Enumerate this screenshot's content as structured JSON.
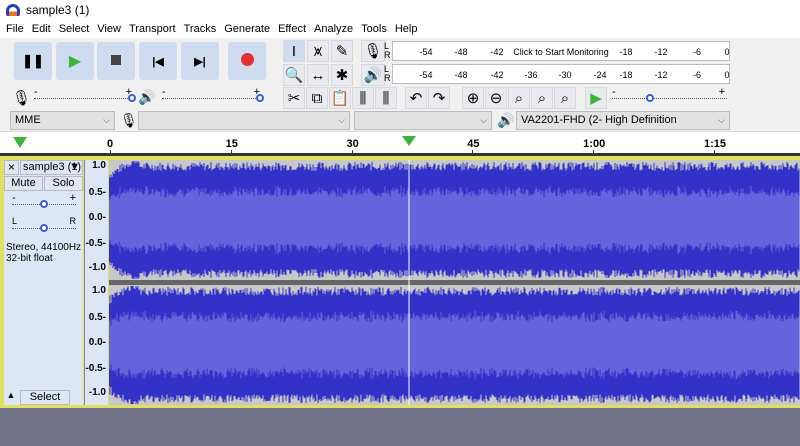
{
  "window": {
    "title": "sample3 (1)",
    "app_icon": "audacity-headphones-icon"
  },
  "menu": [
    "File",
    "Edit",
    "Select",
    "View",
    "Transport",
    "Tracks",
    "Generate",
    "Effect",
    "Analyze",
    "Tools",
    "Help"
  ],
  "transport": {
    "buttons": [
      "pause",
      "play",
      "stop",
      "skip-to-start",
      "skip-to-end",
      "record"
    ]
  },
  "tools": [
    "selection-tool",
    "envelope-tool",
    "draw-tool",
    "zoom-tool",
    "time-shift-tool",
    "multi-tool"
  ],
  "meters": {
    "record": {
      "channels": [
        "L",
        "R"
      ],
      "ticks": [
        "-54",
        "-48",
        "-42",
        "-18",
        "-12",
        "-6",
        "0"
      ],
      "prompt": "Click to Start Monitoring"
    },
    "playback": {
      "channels": [
        "L",
        "R"
      ],
      "ticks": [
        "-54",
        "-48",
        "-42",
        "-36",
        "-30",
        "-24",
        "-18",
        "-12",
        "-6",
        "0"
      ]
    }
  },
  "mixer": {
    "minus": "-",
    "plus": "+",
    "record_volume": 1.0,
    "playback_volume": 1.0
  },
  "play_at_speed": {
    "minus": "-",
    "plus": "+",
    "speed_level": 0.35
  },
  "devices": {
    "host": "MME",
    "input": "",
    "channels": "",
    "output": "VA2201-FHD (2- High Definition"
  },
  "timeline": {
    "ticks": [
      "0",
      "15",
      "30",
      "45",
      "1:00",
      "1:15"
    ]
  },
  "track": {
    "name": "sample3 (1)",
    "close": "×",
    "mute": "Mute",
    "solo": "Solo",
    "gain": {
      "minus": "-",
      "plus": "+",
      "level": 0.5
    },
    "pan": {
      "left": "L",
      "right": "R",
      "level": 0.5
    },
    "info_line1": "Stereo, 44100Hz",
    "info_line2": "32-bit float",
    "select": "Select",
    "scale": [
      "1.0",
      "0.5-",
      "0.0-",
      "-0.5-",
      "-1.0"
    ]
  },
  "colors": {
    "wave": "#3232c8",
    "wave_rms": "#6464dc",
    "wave_bg": "#c8c8c8",
    "track_border": "#e0e060",
    "bottom_bg": "#72728a",
    "record": "#e03030",
    "play": "#3cb43c"
  }
}
